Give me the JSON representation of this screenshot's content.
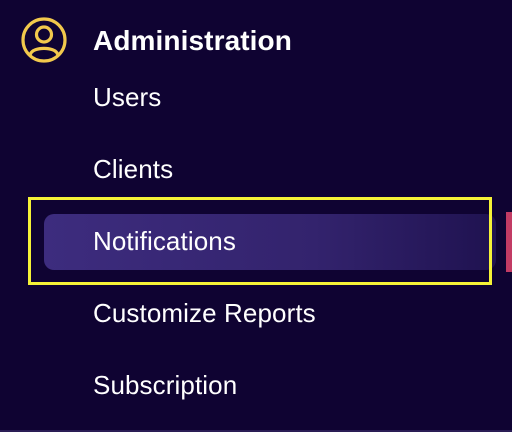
{
  "section": {
    "title": "Administration",
    "icon": "user-circle-icon",
    "icon_color": "#f2c94c"
  },
  "nav": {
    "items": [
      {
        "label": "Users"
      },
      {
        "label": "Clients"
      },
      {
        "label": "Notifications",
        "active": true
      },
      {
        "label": "Customize Reports"
      },
      {
        "label": "Subscription"
      }
    ]
  },
  "colors": {
    "background": "#0f0332",
    "active_item": "#3d2c7e",
    "focus_outline": "#f5f237",
    "edge_indicator": "#c23b64"
  }
}
